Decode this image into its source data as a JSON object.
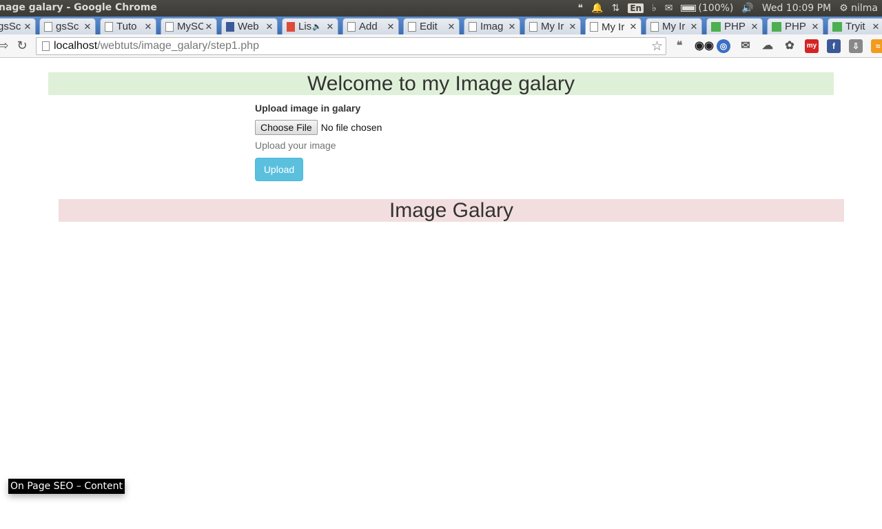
{
  "os_panel": {
    "window_title": "nage galary - Google Chrome",
    "keyboard": "En",
    "battery": "(100%)",
    "clock": "Wed 10:09 PM",
    "user": "nilma"
  },
  "tabs": [
    {
      "label": "gsSc",
      "icon": "page-icon"
    },
    {
      "label": "gsSc",
      "icon": "page-icon"
    },
    {
      "label": "Tuto",
      "icon": "page-icon"
    },
    {
      "label": "MySC",
      "icon": "page-icon"
    },
    {
      "label": "Web",
      "icon": "facebook-icon"
    },
    {
      "label": "Lis",
      "icon": "g-icon"
    },
    {
      "label": "Add",
      "icon": "page-icon"
    },
    {
      "label": "Edit",
      "icon": "page-icon"
    },
    {
      "label": "Imag",
      "icon": "page-icon"
    },
    {
      "label": "My Ir",
      "icon": "page-icon"
    },
    {
      "label": "My Ir",
      "icon": "page-icon",
      "active": true
    },
    {
      "label": "My Ir",
      "icon": "page-icon"
    },
    {
      "label": "PHP",
      "icon": "w3-icon"
    },
    {
      "label": "PHP",
      "icon": "w3-icon"
    },
    {
      "label": "Tryit",
      "icon": "w3-icon"
    }
  ],
  "toolbar": {
    "url_host": "localhost",
    "url_path": "/webtuts/image_galary/step1.php"
  },
  "page": {
    "welcome_heading": "Welcome to my Image galary",
    "upload_label": "Upload image in galary",
    "choose_file": "Choose File",
    "no_file": "No file chosen",
    "help_text": "Upload your image",
    "upload_button": "Upload",
    "galary_heading": "Image Galary"
  },
  "tooltip": "On Page SEO – Content",
  "colors": {
    "welcome_bg": "#dff0d8",
    "galary_bg": "#f2dede",
    "upload_btn": "#5bc0de"
  }
}
